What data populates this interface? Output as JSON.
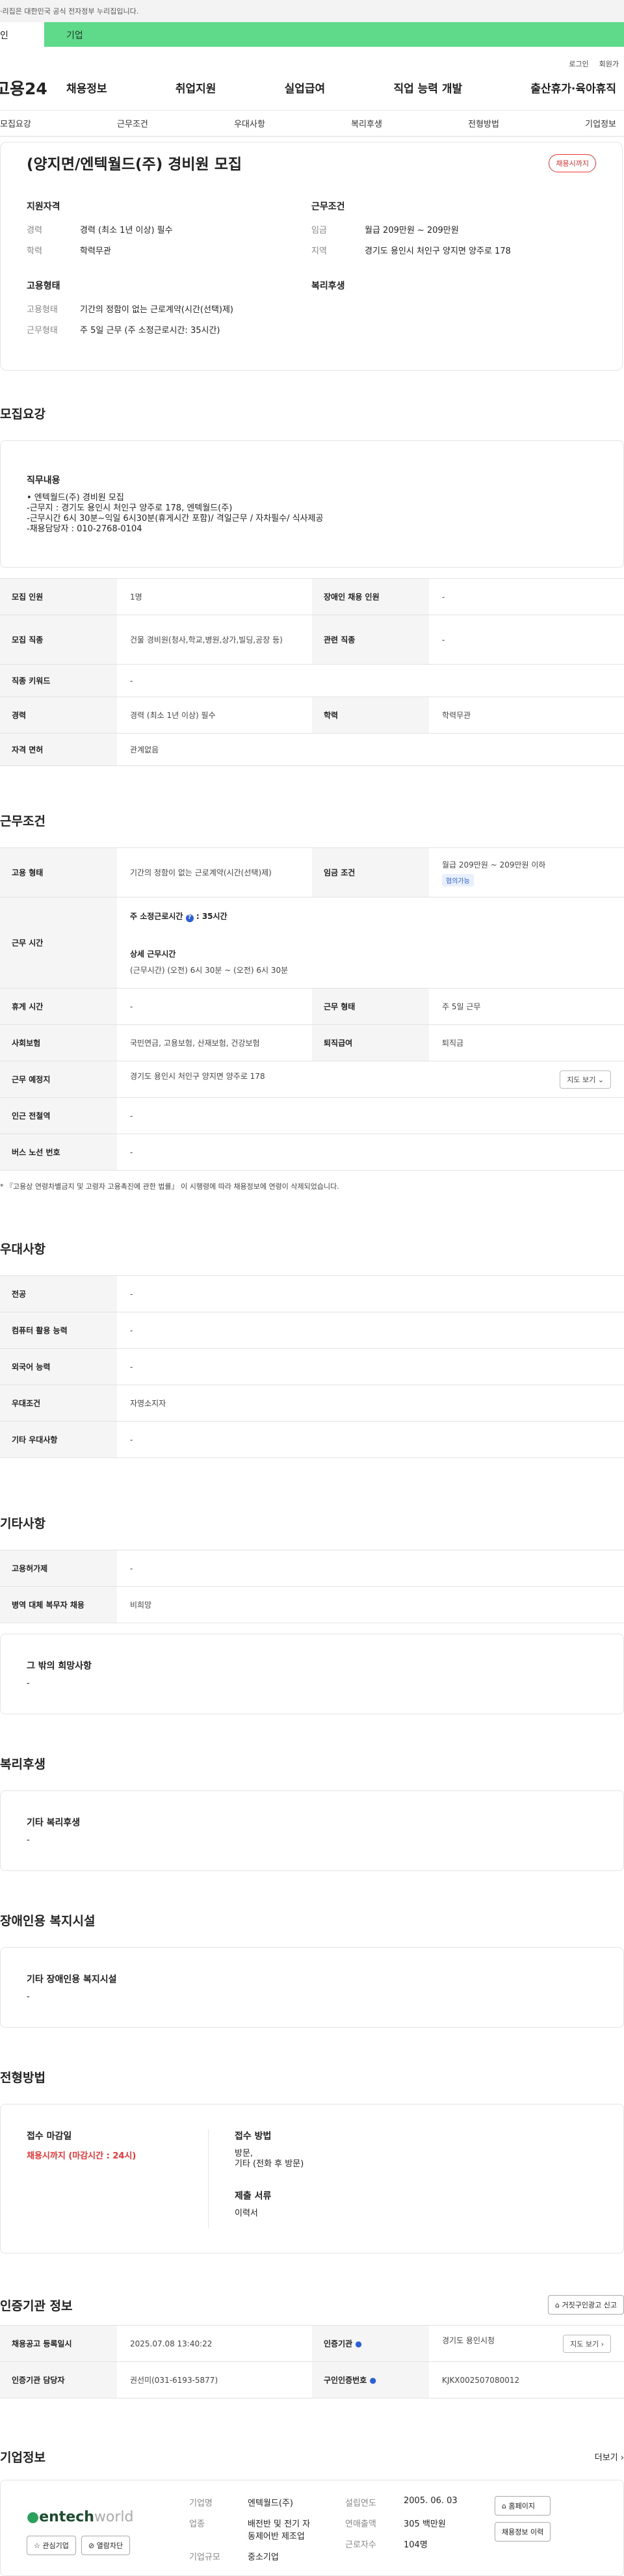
{
  "gov": {
    "banner": "·리집은 대한민국 공식 전자정부 누리집입니다."
  },
  "tabs": {
    "personal": "인",
    "company": "기업"
  },
  "util": {
    "login": "로그인",
    "join": "회원가"
  },
  "gnb": {
    "logo": "고용24",
    "menu": [
      "채용정보",
      "취업지원",
      "실업급여",
      "직업 능력 개발",
      "출산휴가·육아휴직"
    ]
  },
  "anchors": [
    "모집요강",
    "근무조건",
    "우대사항",
    "복리후생",
    "전형방법",
    "기업정보"
  ],
  "hero": {
    "title": "(양지면/엔텍월드(주) 경비원 모집",
    "badge": "채용시까지",
    "qual": {
      "h": "지원자격",
      "items": [
        {
          "k": "경력",
          "v": "경력 (최소 1년 이상) 필수"
        },
        {
          "k": "학력",
          "v": "학력무관"
        }
      ]
    },
    "cond": {
      "h": "근무조건",
      "items": [
        {
          "k": "임금",
          "v": "월급 209만원 ~ 209만원"
        },
        {
          "k": "지역",
          "v": "경기도 용인시 처인구 양지면 양주로 178"
        }
      ]
    },
    "emp": {
      "h": "고용형태",
      "items": [
        {
          "k": "고용형태",
          "v": "기간의 정함이 없는 근로계약(시간(선택)제)"
        },
        {
          "k": "근무형태",
          "v": "주 5일 근무 (주 소정근로시간: 35시간)"
        }
      ]
    },
    "welfare": {
      "h": "복리후생"
    }
  },
  "recruit": {
    "title": "모집요강",
    "job_h": "직무내용",
    "job_lines": [
      "• 엔텍월드(주) 경비원 모집",
      "-근무지 : 경기도 용인시 처인구 양주로 178, 엔텍월드(주)",
      "-근무시간 6시 30분~익일 6시30분(휴게시간 포함)/ 격일근무 / 자차필수/ 식사제공",
      "-채용담당자 : 010-2768-0104"
    ],
    "rows": [
      {
        "k1": "모집 인원",
        "v1": "1명",
        "k2": "장애인 채용 인원",
        "v2": "-"
      },
      {
        "k1": "모집 직종",
        "v1": "건물 경비원(청사,학교,병원,상가,빌딩,공장 등)",
        "k2": "관련 직종",
        "v2": "-"
      },
      {
        "k1": "직종 키워드",
        "v1": "-"
      },
      {
        "k1": "경력",
        "v1": "경력 (최소 1년 이상) 필수",
        "k2": "학력",
        "v2": "학력무관"
      },
      {
        "k1": "자격 면허",
        "v1": "관계없음"
      }
    ]
  },
  "work": {
    "title": "근무조건",
    "row1": {
      "k1": "고용 형태",
      "v1": "기간의 정함이 없는 근로계약(시간(선택)제)",
      "k2": "임금 조건",
      "v2": "월급 209만원 ~ 209만원 이하",
      "v2b": "협의가능"
    },
    "row2": {
      "k": "근무 시간",
      "a": "주 소정근로시간",
      "a_val": "35시간",
      "b": "상세 근무시간",
      "b_val": "(근무시간) (오전) 6시 30분 ~ (오전) 6시 30분"
    },
    "row3": {
      "k1": "휴게 시간",
      "v1": "-",
      "k2": "근무 형태",
      "v2": "주 5일 근무"
    },
    "row4": {
      "k1": "사회보험",
      "v1": "국민연금, 고용보험, 산재보험, 건강보험",
      "k2": "퇴직급여",
      "v2": "퇴직금"
    },
    "row5": {
      "k": "근무 예정지",
      "v": "경기도 용인시 처인구 양지면 양주로 178",
      "btn": "지도 보기"
    },
    "row6": {
      "k": "인근 전철역",
      "v": "-"
    },
    "row7": {
      "k": "버스 노선 번호",
      "v": "-"
    },
    "note": "* 『고용상 연령차별금지 및 고령자 고용촉진에 관한 법률』 이 시행령에 따라 채용정보에 연령이 삭제되었습니다."
  },
  "pref": {
    "title": "우대사항",
    "rows": [
      {
        "k": "전공",
        "v": "-"
      },
      {
        "k": "컴퓨터 활용 능력",
        "v": "-"
      },
      {
        "k": "외국어 능력",
        "v": "-"
      },
      {
        "k": "우대조건",
        "v": "자영소지자"
      },
      {
        "k": "기타 우대사항",
        "v": "-"
      }
    ]
  },
  "etc": {
    "title": "기타사항",
    "rows": [
      {
        "k": "고용허가제",
        "v": "-"
      },
      {
        "k": "병역 대체 복무자 채용",
        "v": "비희망"
      }
    ],
    "box_h": "그 밖의 희망사항",
    "box_v": "-"
  },
  "benefit": {
    "title": "복리후생",
    "h": "기타 복리후생",
    "v": "-"
  },
  "facility": {
    "title": "장애인용 복지시설",
    "h": "기타 장애인용 복지시설",
    "v": "-"
  },
  "process": {
    "title": "전형방법",
    "deadline_h": "접수 마감일",
    "deadline_v": "채용시까지 (마감시간 : 24시)",
    "method_h": "접수 방법",
    "method_v1": "방문,",
    "method_v2": "기타 (전화 후 방문)",
    "docs_h": "제출 서류",
    "docs_v": "이력서"
  },
  "cert": {
    "title": "인증기관 정보",
    "report": "거짓구인광고 신고",
    "reg_k": "채용공고 등록일시",
    "reg_v": "2025.07.08 13:40:22",
    "org_k": "인증기관",
    "org_v": "경기도 용인시청",
    "map": "지도 보기",
    "mgr_k": "인증기관 담당자",
    "mgr_v": "권선미(031-6193-5877)",
    "num_k": "구인인증번호",
    "num_v": "KJKX002507080012"
  },
  "company": {
    "title": "기업정보",
    "more": "더보기",
    "logo1": "entech",
    "logo2": "world",
    "fav": "관심기업",
    "block": "열람차단",
    "name_k": "기업명",
    "name_v": "엔텍월드(주)",
    "biz_k": "업종",
    "biz_v1": "배전반 및 전기 자",
    "biz_v2": "동제어반 제조업",
    "size_k": "기업규모",
    "size_v": "중소기업",
    "est_k": "설립연도",
    "est_v": "2005. 06. 03",
    "sales_k": "연매출액",
    "sales_v": "305 백만원",
    "emp_k": "근로자수",
    "emp_v": "104명",
    "home": "홈페이지",
    "history": "채용정보 이력"
  }
}
